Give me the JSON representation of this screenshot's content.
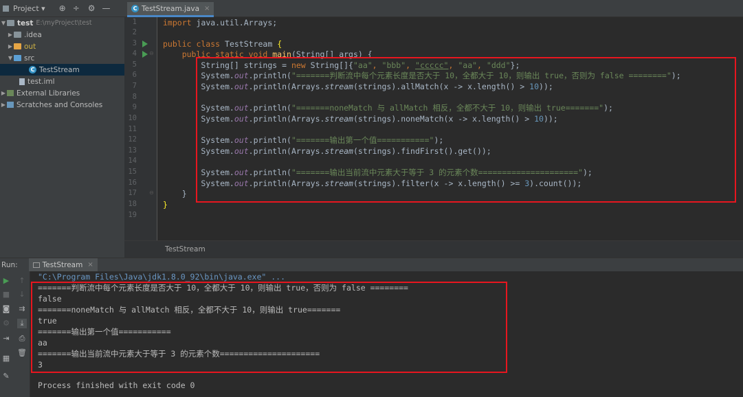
{
  "project_panel": {
    "header_label": "Project ▾",
    "tree": [
      {
        "label": "test",
        "path": "E:\\myProject\\test"
      },
      {
        "label": ".idea"
      },
      {
        "label": "out"
      },
      {
        "label": "src"
      },
      {
        "label": "TestStream"
      },
      {
        "label": "test.iml"
      },
      {
        "label": "External Libraries"
      },
      {
        "label": "Scratches and Consoles"
      }
    ]
  },
  "editor": {
    "tab_label": "TestStream.java",
    "line_numbers": [
      "1",
      "2",
      "3",
      "4",
      "5",
      "6",
      "7",
      "8",
      "9",
      "10",
      "11",
      "12",
      "13",
      "14",
      "15",
      "16",
      "17",
      "18",
      "19"
    ],
    "breadcrumb": "TestStream"
  },
  "code": {
    "l1a": "import",
    "l1b": " java.util.Arrays;",
    "l3a": "public class",
    "l3b": " TestStream ",
    "l3c": "{",
    "l4a": "    public static void ",
    "l4b": "main",
    "l4c": "(String[] args) {",
    "l5a": "        String[] strings = ",
    "l5b": "new",
    "l5c": " String[]{",
    "l5s1": "\"aa\"",
    "l5s2": "\"bbb\"",
    "l5s3": "\"ccccc\"",
    "l5s4": "\"aa\"",
    "l5s5": "\"ddd\"",
    "l5end": "};",
    "println_prefix": "        System.",
    "out": "out",
    "println": ".println(",
    "l6str": "\"=======判断流中每个元素长度是否大于 10，全都大于 10，则输出 true，否则为 false ========\"",
    "l7a": "Arrays.",
    "l7b": "stream",
    "l7c": "(strings).allMatch(x -> x.length() > ",
    "l7n": "10",
    "l7d": "));",
    "l9str": "\"=======noneMatch 与 allMatch 相反，全都不大于 10，则输出 true=======\"",
    "l10c": "(strings).noneMatch(x -> x.length() > ",
    "l12str": "\"=======输出第一个值===========\"",
    "l13c": "(strings).findFirst().get());",
    "l15str": "\"=======输出当前流中元素大于等于 3 的元素个数=====================\"",
    "l16c": "(strings).filter(x -> x.length() >= ",
    "l16n": "3",
    "l16d": ").count());",
    "close_semi": ");",
    "l17": "    }",
    "l18": "}"
  },
  "run_panel": {
    "label": "Run:",
    "tab_label": "TestStream",
    "command": "\"C:\\Program Files\\Java\\jdk1.8.0_92\\bin\\java.exe\" ...",
    "output": [
      "=======判断流中每个元素长度是否大于 10，全都大于 10，则输出 true，否则为 false ========",
      "false",
      "=======noneMatch 与 allMatch 相反，全都不大于 10，则输出 true=======",
      "true",
      "=======输出第一个值===========",
      "aa",
      "=======输出当前流中元素大于等于 3 的元素个数=====================",
      "3"
    ],
    "exit_message": "Process finished with exit code 0"
  },
  "colors": {
    "highlight_box": "#e8161f",
    "keyword": "#cc7832",
    "string": "#6a8759",
    "number": "#6897bb"
  }
}
